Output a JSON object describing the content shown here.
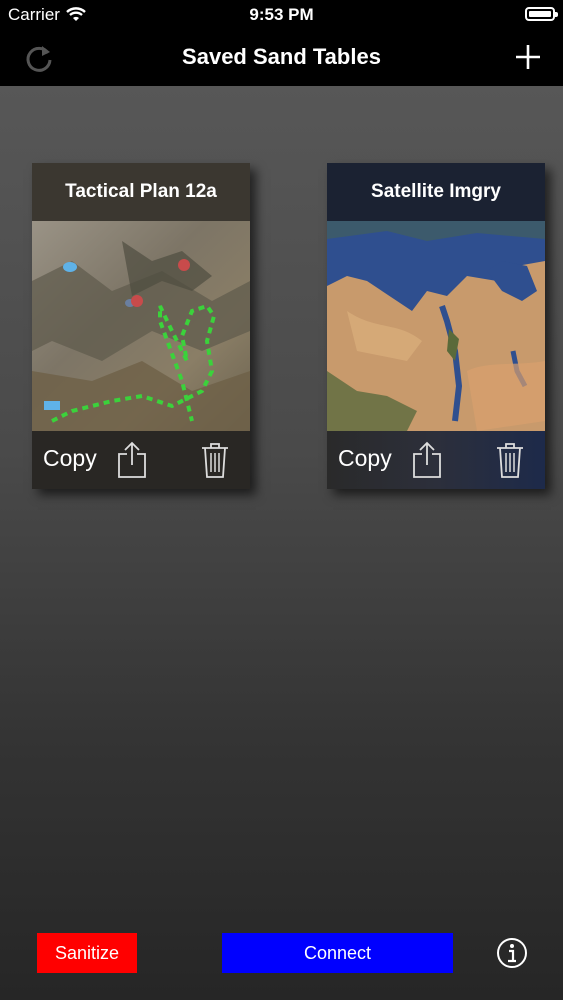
{
  "status_bar": {
    "carrier": "Carrier",
    "time": "9:53 PM"
  },
  "nav": {
    "title": "Saved Sand Tables"
  },
  "cards": [
    {
      "title": "Tactical Plan 12a",
      "copy_label": "Copy"
    },
    {
      "title": "Satellite Imgry",
      "copy_label": "Copy"
    }
  ],
  "bottom": {
    "sanitize_label": "Sanitize",
    "connect_label": "Connect"
  },
  "colors": {
    "sanitize": "#ff0000",
    "connect": "#0000ff"
  }
}
